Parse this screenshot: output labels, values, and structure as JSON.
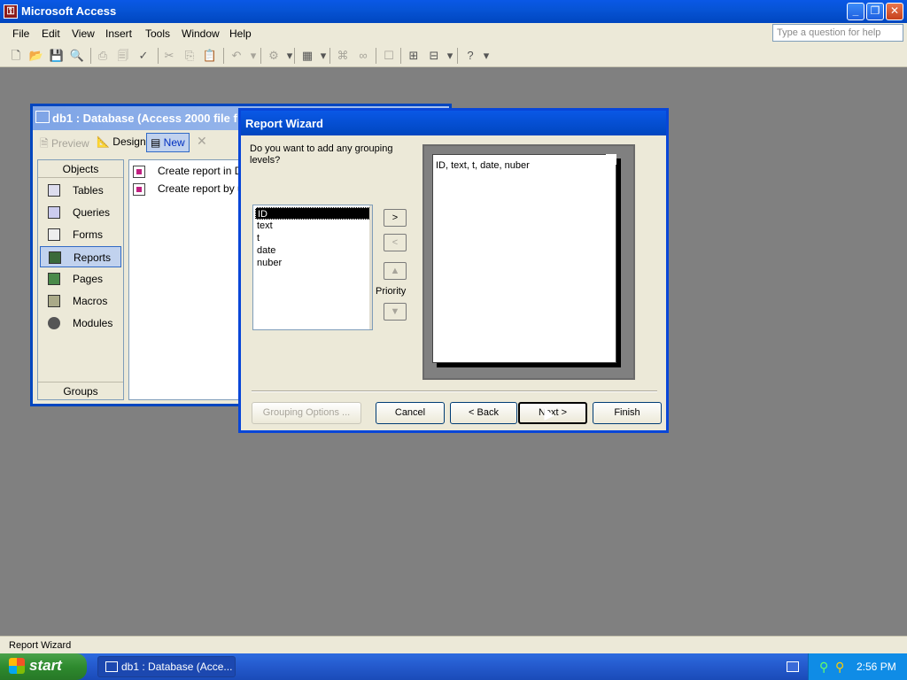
{
  "app": {
    "title": "Microsoft Access",
    "window_buttons": {
      "minimize": "_",
      "restore": "❐",
      "close": "✕"
    }
  },
  "menu": {
    "items": [
      "File",
      "Edit",
      "View",
      "Insert",
      "Tools",
      "Window",
      "Help"
    ],
    "help_placeholder": "Type a question for help"
  },
  "db_window": {
    "title": "db1 : Database (Access 2000 file f",
    "toolbar": {
      "preview": "Preview",
      "design": "Design",
      "new": "New",
      "delete": "✕"
    },
    "objects_header": "Objects",
    "objects": [
      "Tables",
      "Queries",
      "Forms",
      "Reports",
      "Pages",
      "Macros",
      "Modules"
    ],
    "selected_object": "Reports",
    "groups_label": "Groups",
    "list_items": [
      "Create report in Design view",
      "Create report by using wizard"
    ]
  },
  "wizard": {
    "title": "Report Wizard",
    "question": "Do you want to add any grouping levels?",
    "fields": [
      "ID",
      "text",
      "t",
      "date",
      "nuber"
    ],
    "selected_field": "ID",
    "add_label": ">",
    "remove_label": "<",
    "priority_label": "Priority",
    "preview_text": "ID, text, t, date, nuber",
    "buttons": {
      "grouping_options": "Grouping Options ...",
      "cancel": "Cancel",
      "back": "< Back",
      "next": "Next >",
      "finish": "Finish"
    }
  },
  "status": {
    "text": "Report Wizard"
  },
  "taskbar": {
    "start_label": "start",
    "task_label": "db1 : Database (Acce...",
    "clock": "2:56 PM"
  },
  "colors": {
    "accent": "#0a58e6",
    "taskbar": "#2459cc",
    "start": "#2e8a2e"
  }
}
